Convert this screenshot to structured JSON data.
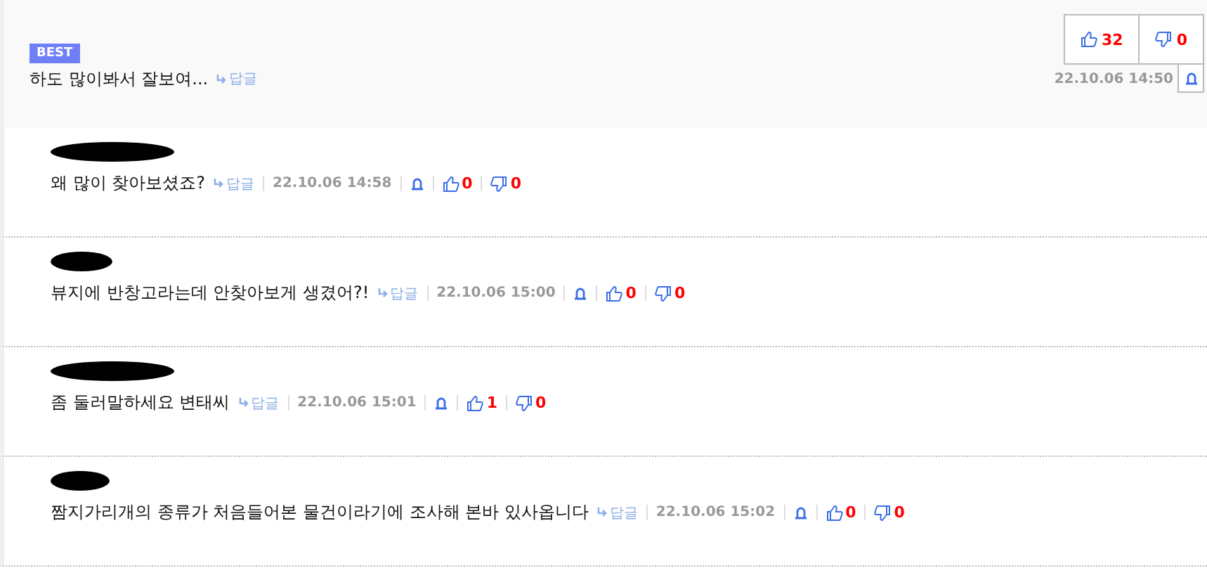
{
  "best_comment": {
    "badge": "BEST",
    "text": "하도 많이봐서 잘보여...",
    "reply_label": "답글",
    "likes": "32",
    "dislikes": "0",
    "time": "22.10.06 14:50"
  },
  "replies": [
    {
      "text": "왜 많이 찾아보셨죠?",
      "reply_label": "답글",
      "time": "22.10.06 14:58",
      "likes": "0",
      "dislikes": "0"
    },
    {
      "text": "뷰지에 반창고라는데 안찾아보게 생겼어?!",
      "reply_label": "답글",
      "time": "22.10.06 15:00",
      "likes": "0",
      "dislikes": "0"
    },
    {
      "text": "좀 둘러말하세요 변태씨",
      "reply_label": "답글",
      "time": "22.10.06 15:01",
      "likes": "1",
      "dislikes": "0"
    },
    {
      "text": "짬지가리개의 종류가 처음들어본 물건이라기에 조사해 본바 있사옵니다",
      "reply_label": "답글",
      "time": "22.10.06 15:02",
      "likes": "0",
      "dislikes": "0"
    }
  ]
}
